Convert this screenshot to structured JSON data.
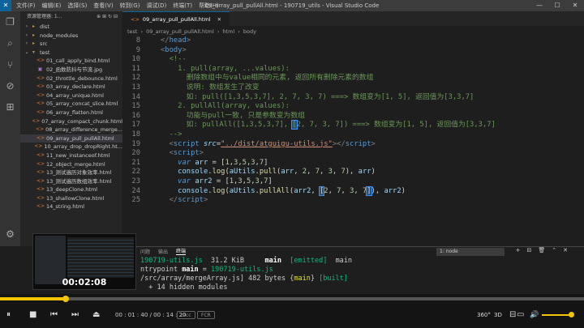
{
  "titlebar": {
    "logo": "✕",
    "menu": [
      "文件(F)",
      "编辑(E)",
      "选择(S)",
      "查看(V)",
      "转到(G)",
      "调试(D)",
      "终端(T)",
      "帮助(H)"
    ],
    "title": "09_array_pull_pullAll.html - 190719_utils - Visual Studio Code",
    "controls": [
      "—",
      "☐",
      "✕"
    ]
  },
  "activity_icons": [
    "files-icon",
    "search-icon",
    "source-control-icon",
    "debug-icon",
    "extensions-icon"
  ],
  "sidebar": {
    "title": "资源管理器: 1...",
    "actions": "⊕ ⊞ ↻ ⊟",
    "items": [
      {
        "arrow": "›",
        "icon": "▸",
        "label": "dist",
        "type": "folder",
        "depth": 0
      },
      {
        "arrow": "›",
        "icon": "▸",
        "label": "node_modules",
        "type": "folder",
        "depth": 0
      },
      {
        "arrow": "›",
        "icon": "▸",
        "label": "src",
        "type": "folder",
        "depth": 0
      },
      {
        "arrow": "⌄",
        "icon": "▾",
        "label": "test",
        "type": "folder",
        "depth": 0
      },
      {
        "arrow": "",
        "icon": "<>",
        "label": "01_call_apply_bind.html",
        "type": "html",
        "depth": 1
      },
      {
        "arrow": "",
        "icon": "▣",
        "label": "02_函数防抖与节流.jpg",
        "type": "img",
        "depth": 1
      },
      {
        "arrow": "",
        "icon": "<>",
        "label": "02_throttle_debounce.html",
        "type": "html",
        "depth": 1
      },
      {
        "arrow": "",
        "icon": "<>",
        "label": "03_array_declare.html",
        "type": "html",
        "depth": 1
      },
      {
        "arrow": "",
        "icon": "<>",
        "label": "04_array_unique.html",
        "type": "html",
        "depth": 1
      },
      {
        "arrow": "",
        "icon": "<>",
        "label": "05_array_concat_slice.html",
        "type": "html",
        "depth": 1
      },
      {
        "arrow": "",
        "icon": "<>",
        "label": "06_array_flatten.html",
        "type": "html",
        "depth": 1
      },
      {
        "arrow": "",
        "icon": "<>",
        "label": "07_array_compact_chunk.html",
        "type": "html",
        "depth": 1
      },
      {
        "arrow": "",
        "icon": "<>",
        "label": "08_array_difference_merge...",
        "type": "html",
        "depth": 1
      },
      {
        "arrow": "",
        "icon": "<>",
        "label": "09_array_pull_pullAll.html",
        "type": "html",
        "depth": 1,
        "active": true
      },
      {
        "arrow": "",
        "icon": "<>",
        "label": "10_array_drop_dropRight.ht...",
        "type": "html",
        "depth": 1
      },
      {
        "arrow": "",
        "icon": "<>",
        "label": "11_new_instanceof.html",
        "type": "html",
        "depth": 1
      },
      {
        "arrow": "",
        "icon": "<>",
        "label": "12_object_merge.html",
        "type": "html",
        "depth": 1
      },
      {
        "arrow": "",
        "icon": "<>",
        "label": "13_测试遍历对象效率.html",
        "type": "html",
        "depth": 1
      },
      {
        "arrow": "",
        "icon": "<>",
        "label": "13_测试遍历数组效率.html",
        "type": "html",
        "depth": 1
      },
      {
        "arrow": "",
        "icon": "<>",
        "label": "13_deepClone.html",
        "type": "html",
        "depth": 1
      },
      {
        "arrow": "",
        "icon": "<>",
        "label": "13_shallowClone.html",
        "type": "html",
        "depth": 1
      },
      {
        "arrow": "",
        "icon": "<>",
        "label": "14_string.html",
        "type": "html",
        "depth": 1
      }
    ]
  },
  "editor": {
    "tab": {
      "icon": "<>",
      "label": "09_array_pull_pullAll.html",
      "close": "✕"
    },
    "breadcrumb": [
      "test",
      "09_array_pull_pullAll.html",
      "html",
      "body"
    ],
    "breadcrumb_sep": "›",
    "lines": [
      {
        "n": "8",
        "tokens": [
          {
            "t": "</",
            "c": "punc"
          },
          {
            "t": "head",
            "c": "tag"
          },
          {
            "t": ">",
            "c": "punc"
          }
        ]
      },
      {
        "n": "9",
        "tokens": [
          {
            "t": "<",
            "c": "punc"
          },
          {
            "t": "body",
            "c": "tag"
          },
          {
            "t": ">",
            "c": "punc"
          }
        ]
      },
      {
        "n": "10",
        "tokens": [
          {
            "t": "  <!--",
            "c": "comment"
          }
        ]
      },
      {
        "n": "11",
        "tokens": [
          {
            "t": "    1. pull(array, ...values):",
            "c": "comment"
          }
        ]
      },
      {
        "n": "12",
        "tokens": [
          {
            "t": "      删除数组中与value相同的元素, 返回所有删除元素的数组",
            "c": "comment"
          }
        ]
      },
      {
        "n": "13",
        "tokens": [
          {
            "t": "      说明: 数组发生了改变",
            "c": "comment"
          }
        ]
      },
      {
        "n": "14",
        "tokens": [
          {
            "t": "      如: pull([1,3,5,3,7], 2, 7, 3, 7) ===> 数组变为[1, 5], 返回值为[3,3,7]",
            "c": "comment"
          }
        ]
      },
      {
        "n": "15",
        "tokens": [
          {
            "t": "    2. pullAll(array, values):",
            "c": "comment"
          }
        ]
      },
      {
        "n": "16",
        "tokens": [
          {
            "t": "      功能与pull一致, 只是参数变为数组",
            "c": "comment"
          }
        ]
      },
      {
        "n": "17",
        "tokens": [
          {
            "t": "      如: pullAll([1,3,5,3,7], ",
            "c": "comment"
          },
          {
            "t": "[",
            "c": "comment",
            "sel": true
          },
          {
            "t": "2, 7, 3, 7]) ===> 数组变为[1, 5], 返回值为[3,3,7]",
            "c": "comment"
          }
        ]
      },
      {
        "n": "18",
        "tokens": [
          {
            "t": "  -->",
            "c": "comment"
          }
        ]
      },
      {
        "n": "19",
        "tokens": [
          {
            "t": "  <",
            "c": "punc"
          },
          {
            "t": "script",
            "c": "tag"
          },
          {
            "t": " ",
            "c": "plain"
          },
          {
            "t": "src",
            "c": "attr"
          },
          {
            "t": "=",
            "c": "plain"
          },
          {
            "t": "\"../dist/atguigu-utils.js\"",
            "c": "str"
          },
          {
            "t": "></",
            "c": "punc"
          },
          {
            "t": "script",
            "c": "tag"
          },
          {
            "t": ">",
            "c": "punc"
          }
        ]
      },
      {
        "n": "20",
        "tokens": [
          {
            "t": "  <",
            "c": "punc"
          },
          {
            "t": "script",
            "c": "tag"
          },
          {
            "t": ">",
            "c": "punc"
          }
        ]
      },
      {
        "n": "21",
        "tokens": [
          {
            "t": "    var",
            "c": "key"
          },
          {
            "t": " ",
            "c": "plain"
          },
          {
            "t": "arr",
            "c": "var"
          },
          {
            "t": " = [",
            "c": "plain"
          },
          {
            "t": "1",
            "c": "num"
          },
          {
            "t": ",",
            "c": "plain"
          },
          {
            "t": "3",
            "c": "num"
          },
          {
            "t": ",",
            "c": "plain"
          },
          {
            "t": "5",
            "c": "num"
          },
          {
            "t": ",",
            "c": "plain"
          },
          {
            "t": "3",
            "c": "num"
          },
          {
            "t": ",",
            "c": "plain"
          },
          {
            "t": "7",
            "c": "num"
          },
          {
            "t": "]",
            "c": "plain"
          }
        ]
      },
      {
        "n": "22",
        "tokens": [
          {
            "t": "    console",
            "c": "var"
          },
          {
            "t": ".",
            "c": "plain"
          },
          {
            "t": "log",
            "c": "fn"
          },
          {
            "t": "(",
            "c": "plain"
          },
          {
            "t": "aUtils",
            "c": "var"
          },
          {
            "t": ".",
            "c": "plain"
          },
          {
            "t": "pull",
            "c": "fn"
          },
          {
            "t": "(",
            "c": "plain"
          },
          {
            "t": "arr",
            "c": "var"
          },
          {
            "t": ", ",
            "c": "plain"
          },
          {
            "t": "2",
            "c": "num"
          },
          {
            "t": ", ",
            "c": "plain"
          },
          {
            "t": "7",
            "c": "num"
          },
          {
            "t": ", ",
            "c": "plain"
          },
          {
            "t": "3",
            "c": "num"
          },
          {
            "t": ", ",
            "c": "plain"
          },
          {
            "t": "7",
            "c": "num"
          },
          {
            "t": "), ",
            "c": "plain"
          },
          {
            "t": "arr",
            "c": "var"
          },
          {
            "t": ")",
            "c": "plain"
          }
        ]
      },
      {
        "n": "23",
        "tokens": [
          {
            "t": "    var",
            "c": "key"
          },
          {
            "t": " ",
            "c": "plain"
          },
          {
            "t": "arr2",
            "c": "var"
          },
          {
            "t": " = [",
            "c": "plain"
          },
          {
            "t": "1",
            "c": "num"
          },
          {
            "t": ",",
            "c": "plain"
          },
          {
            "t": "3",
            "c": "num"
          },
          {
            "t": ",",
            "c": "plain"
          },
          {
            "t": "5",
            "c": "num"
          },
          {
            "t": ",",
            "c": "plain"
          },
          {
            "t": "3",
            "c": "num"
          },
          {
            "t": ",",
            "c": "plain"
          },
          {
            "t": "7",
            "c": "num"
          },
          {
            "t": "]",
            "c": "plain"
          }
        ]
      },
      {
        "n": "24",
        "tokens": [
          {
            "t": "    console",
            "c": "var"
          },
          {
            "t": ".",
            "c": "plain"
          },
          {
            "t": "log",
            "c": "fn"
          },
          {
            "t": "(",
            "c": "plain"
          },
          {
            "t": "aUtils",
            "c": "var"
          },
          {
            "t": ".",
            "c": "plain"
          },
          {
            "t": "pullAll",
            "c": "fn"
          },
          {
            "t": "(",
            "c": "plain"
          },
          {
            "t": "arr2",
            "c": "var"
          },
          {
            "t": ", ",
            "c": "plain"
          },
          {
            "t": "[",
            "c": "plain",
            "sel": true
          },
          {
            "t": "2",
            "c": "num"
          },
          {
            "t": ", ",
            "c": "plain"
          },
          {
            "t": "7",
            "c": "num"
          },
          {
            "t": ", ",
            "c": "plain"
          },
          {
            "t": "3",
            "c": "num"
          },
          {
            "t": ", ",
            "c": "plain"
          },
          {
            "t": "7",
            "c": "num"
          },
          {
            "t": "]",
            "c": "plain",
            "sel": true
          },
          {
            "t": "), ",
            "c": "plain"
          },
          {
            "t": "arr2",
            "c": "var"
          },
          {
            "t": ")",
            "c": "plain"
          }
        ]
      },
      {
        "n": "25",
        "tokens": [
          {
            "t": "  </",
            "c": "punc"
          },
          {
            "t": "script",
            "c": "tag"
          },
          {
            "t": ">",
            "c": "punc"
          }
        ]
      }
    ]
  },
  "panel": {
    "tabs": [
      "问题",
      "输出",
      "终端"
    ],
    "active_tab": "终端",
    "terminal_select": "1: node",
    "icons": [
      "+",
      "⊟",
      "🗑",
      "⌃",
      "✕"
    ],
    "lines": [
      [
        {
          "t": "190719-utils.js",
          "c": "green"
        },
        {
          "t": "  31.2 KiB     ",
          "c": ""
        },
        {
          "t": "main",
          "c": "bold"
        },
        {
          "t": "  ",
          "c": ""
        },
        {
          "t": "[emitted]",
          "c": "green"
        },
        {
          "t": "  main",
          "c": ""
        }
      ],
      [
        {
          "t": "ntrypoint ",
          "c": ""
        },
        {
          "t": "main",
          "c": "bold"
        },
        {
          "t": " = ",
          "c": ""
        },
        {
          "t": "190719-utils.js",
          "c": "green"
        }
      ],
      [
        {
          "t": "/src/array/mergeArray.js] 482 bytes {",
          "c": ""
        },
        {
          "t": "main",
          "c": "yellow"
        },
        {
          "t": "} ",
          "c": ""
        },
        {
          "t": "[built]",
          "c": "green"
        }
      ],
      [
        {
          "t": "  + 14 hidden modules",
          "c": ""
        }
      ]
    ]
  },
  "thumbnail": {
    "time": "00:02:08"
  },
  "player": {
    "progress": 0.112,
    "current_time": "00 : 01 : 40",
    "separator": " / ",
    "total_time": "00 : 14 : 20",
    "pills": [
      "tacc",
      "FCR"
    ],
    "buttons": [
      "⏸",
      "■",
      "⏮",
      "⏭",
      "⏏"
    ],
    "right_buttons": [
      "360°",
      "3D",
      "⊟",
      "▭",
      "🔊"
    ],
    "volume": 0.9,
    "accent": "#f5c400"
  }
}
